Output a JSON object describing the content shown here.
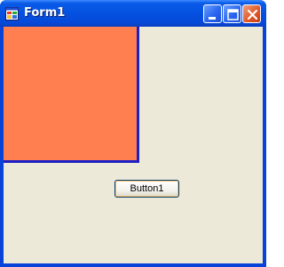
{
  "window": {
    "title": "Form1",
    "controls": [
      "minimize-icon",
      "maximize-icon",
      "close-icon"
    ]
  },
  "form": {
    "button_label": "Button1",
    "panel_color": "#ff7f50",
    "panel_border_color": "#1f20c4",
    "background_color": "#ece9d8"
  }
}
